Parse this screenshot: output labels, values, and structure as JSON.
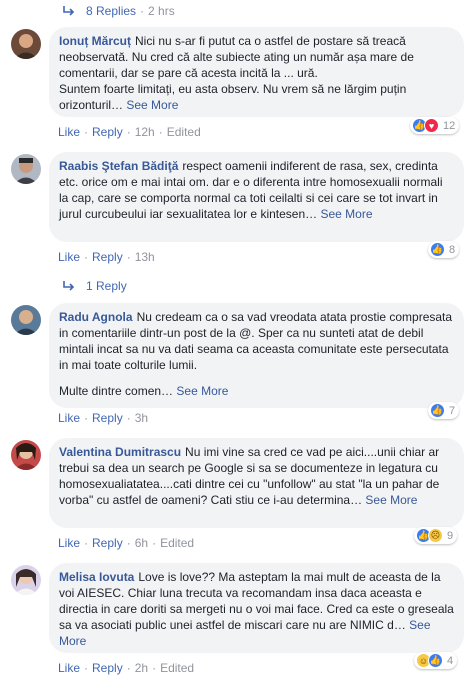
{
  "top_replies": {
    "label": "8 Replies",
    "sep": "·",
    "time": "2 hrs"
  },
  "comments": [
    {
      "name": "Ionuț Mărcuț",
      "text1": "Nici nu s-ar fi putut ca o astfel de postare să treacă neobservată. Nu cred că alte subiecte ating un număr așa mare de comentarii, dar se pare că acesta incită la ... ură.",
      "text2": "Suntem foarte limitați, eu asta observ. Nu vrem să ne lărgim puțin orizonturil…",
      "see_more": "See More",
      "like": "Like",
      "reply": "Reply",
      "dot": "·",
      "time": "12h",
      "edited": "Edited",
      "reaction_count": "12",
      "reactions": [
        "like",
        "love"
      ]
    },
    {
      "name": "Raabis Ştefan Bădiţă",
      "text1": "respect oamenii indiferent de rasa, sex, credinta etc. orice om e mai intai om. dar e o diferenta intre homosexualii normali la cap, care se comporta normal ca toti ceilalti si cei care se tot invart in jurul curcubeului iar sexualitatea lor e kintesen…",
      "see_more": "See More",
      "like": "Like",
      "reply": "Reply",
      "dot": "·",
      "time": "13h",
      "reaction_count": "8",
      "reactions": [
        "like"
      ],
      "replies_label": "1 Reply"
    },
    {
      "name": "Radu Agnola",
      "text1": "Nu credeam ca o sa vad vreodata atata prostie compresata in comentariile dintr-un post de la @. Sper ca nu sunteti atat de debil mintali incat sa nu va dati seama ca aceasta comunitate este persecutata in mai toate colturile lumii.",
      "text2": "Multe dintre comen…",
      "see_more": "See More",
      "like": "Like",
      "reply": "Reply",
      "dot": "·",
      "time": "3h",
      "reaction_count": "7",
      "reactions": [
        "like"
      ]
    },
    {
      "name": "Valentina Dumitrascu",
      "text1": "Nu imi vine sa cred ce vad pe aici....unii chiar ar trebui sa dea un search pe Google si sa se documenteze in legatura cu homosexualiatatea....cati dintre cei cu \"unfollow\" au stat \"la un pahar de vorba\" cu astfel de oameni? Cati stiu ce i-au determina…",
      "see_more": "See More",
      "like": "Like",
      "reply": "Reply",
      "dot": "·",
      "time": "6h",
      "edited": "Edited",
      "reaction_count": "9",
      "reactions": [
        "like",
        "sad"
      ]
    },
    {
      "name": "Melisa Iovuta",
      "text1": "Love is love?? Ma asteptam la mai mult de aceasta de la voi AIESEC. Chiar luna trecuta va recomandam insa daca aceasta e directia in care doriti sa mergeti nu o voi mai face. Cred ca este o greseala sa va asociati public unei astfel de miscari care nu are NIMIC d…",
      "see_more": "See More",
      "like": "Like",
      "reply": "Reply",
      "dot": "·",
      "time": "2h",
      "edited": "Edited",
      "reaction_count": "4",
      "reactions": [
        "haha",
        "like"
      ]
    }
  ],
  "colors": {
    "link": "#385898",
    "action": "#4267b2",
    "muted": "#90949c",
    "bubble": "#f2f3f5"
  }
}
